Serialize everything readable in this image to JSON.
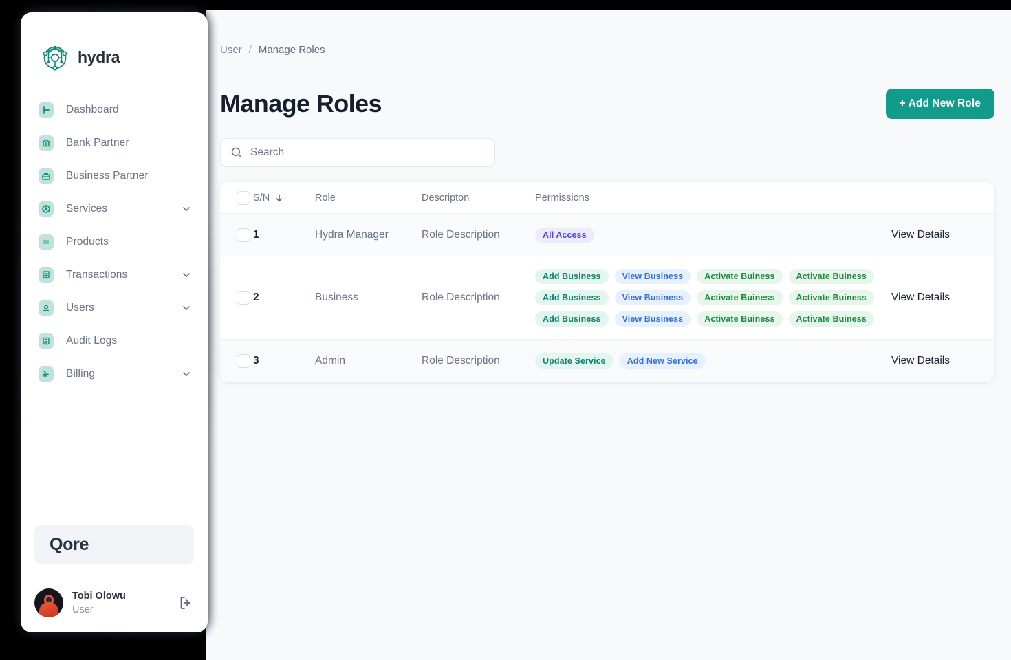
{
  "brand": {
    "name": "hydra",
    "logo_icon": "hydra-network-logo"
  },
  "sidebar": {
    "items": [
      {
        "label": "Dashboard",
        "icon": "dashboard-icon",
        "expandable": false
      },
      {
        "label": "Bank Partner",
        "icon": "bank-icon",
        "expandable": false
      },
      {
        "label": "Business Partner",
        "icon": "briefcase-icon",
        "expandable": false
      },
      {
        "label": "Services",
        "icon": "services-icon",
        "expandable": true
      },
      {
        "label": "Products",
        "icon": "products-icon",
        "expandable": false
      },
      {
        "label": "Transactions",
        "icon": "transactions-icon",
        "expandable": true
      },
      {
        "label": "Users",
        "icon": "users-icon",
        "expandable": true
      },
      {
        "label": "Audit Logs",
        "icon": "audit-logs-icon",
        "expandable": false
      },
      {
        "label": "Billing",
        "icon": "billing-icon",
        "expandable": true
      }
    ],
    "org_card": {
      "name": "Qore"
    },
    "user": {
      "name": "Tobi Olowu",
      "role": "User",
      "logout_icon": "logout-icon"
    }
  },
  "breadcrumb": {
    "parent": "User",
    "separator": "/",
    "current": "Manage Roles"
  },
  "header": {
    "title": "Manage Roles",
    "add_button": "+ Add New Role"
  },
  "search": {
    "placeholder": "Search",
    "value": "",
    "icon": "search-icon"
  },
  "table": {
    "columns": {
      "sn": "S/N",
      "role": "Role",
      "description": "Descripton",
      "permissions": "Permissions"
    },
    "sort_icon": "arrow-down-icon",
    "action_label": "View Details",
    "rows": [
      {
        "sn": "1",
        "role": "Hydra Manager",
        "description": "Role Description",
        "permission_lines": [
          [
            {
              "label": "All Access",
              "color": "indigo"
            }
          ]
        ],
        "action": "View Details"
      },
      {
        "sn": "2",
        "role": "Business",
        "description": "Role Description",
        "permission_lines": [
          [
            {
              "label": "Add Business",
              "color": "teal"
            },
            {
              "label": "View Business",
              "color": "blue"
            },
            {
              "label": "Activate Buiness",
              "color": "green"
            },
            {
              "label": "Activate Buiness",
              "color": "green"
            }
          ],
          [
            {
              "label": "Add Business",
              "color": "teal"
            },
            {
              "label": "View Business",
              "color": "blue"
            },
            {
              "label": "Activate Buiness",
              "color": "green"
            },
            {
              "label": "Activate Buiness",
              "color": "green"
            }
          ],
          [
            {
              "label": "Add Business",
              "color": "teal"
            },
            {
              "label": "View Business",
              "color": "blue"
            },
            {
              "label": "Activate Buiness",
              "color": "green"
            },
            {
              "label": "Activate Buiness",
              "color": "green"
            }
          ]
        ],
        "action": "View Details"
      },
      {
        "sn": "3",
        "role": "Admin",
        "description": "Role Description",
        "permission_lines": [
          [
            {
              "label": "Update Service",
              "color": "teal"
            },
            {
              "label": "Add New Service",
              "color": "blue"
            }
          ]
        ],
        "action": "View Details"
      }
    ]
  },
  "colors": {
    "accent": "#109b8a",
    "sidebar_icon_bg": "#bfe3dc",
    "badge_teal": "#12806f",
    "badge_blue": "#2f6fe4",
    "badge_green": "#1c8a3c",
    "badge_indigo": "#4f46e5",
    "page_bg": "#f7f9fb"
  }
}
